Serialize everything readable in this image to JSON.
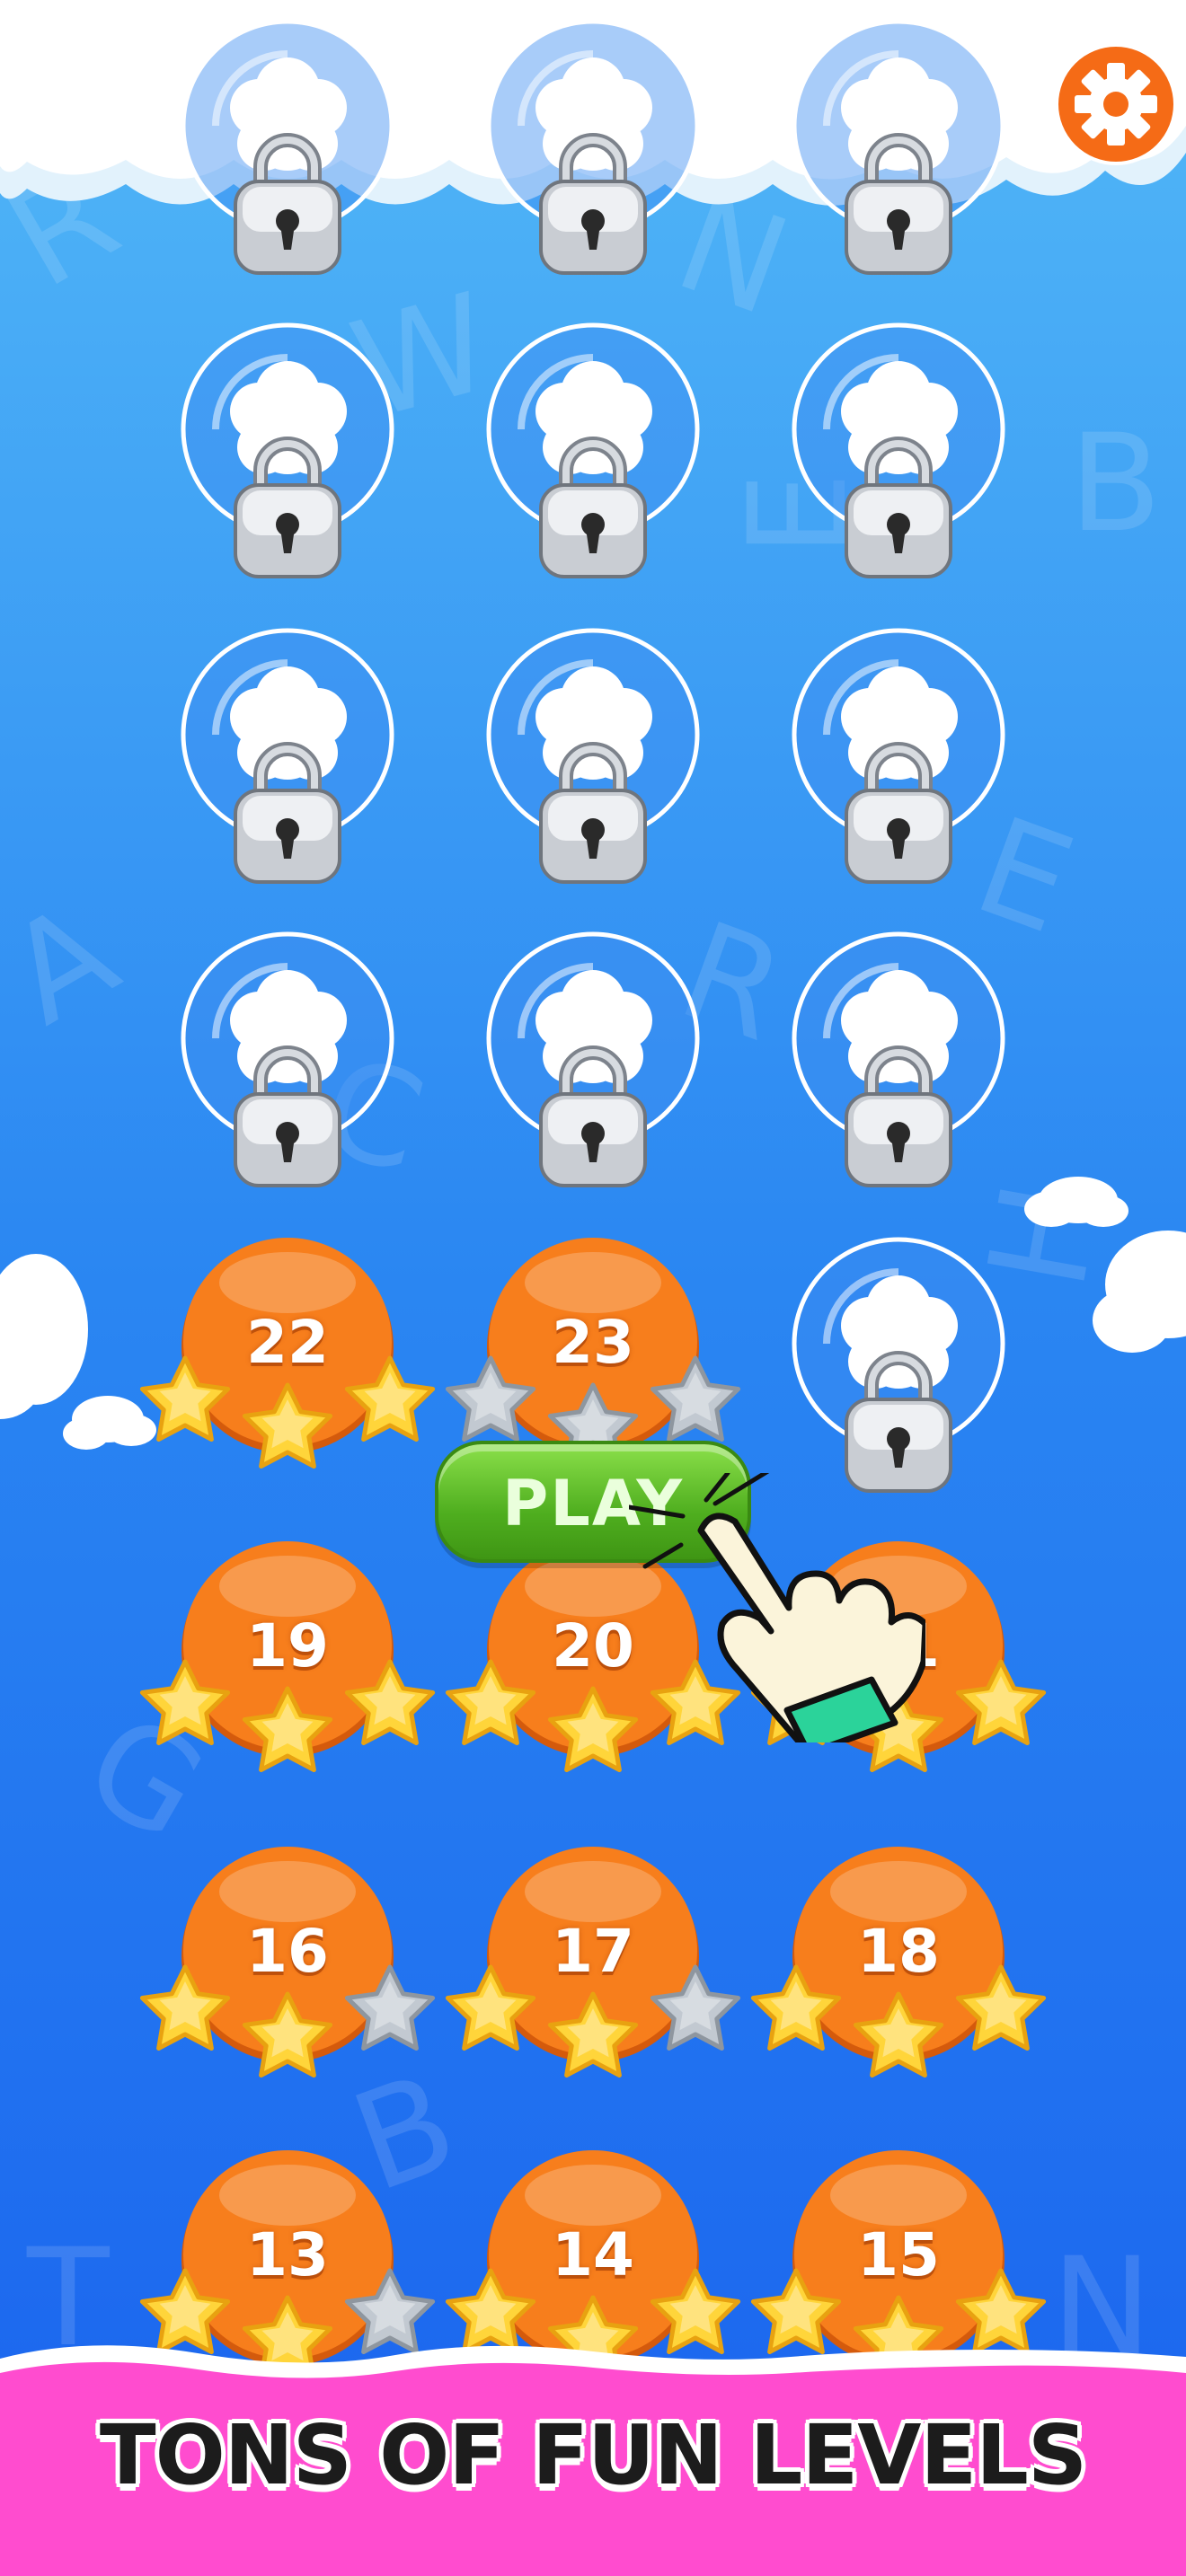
{
  "colors": {
    "sky_top": "#4fb6f6",
    "sky_bottom": "#1d6df0",
    "level_orange": "#f57d1d",
    "star_gold": "#ffd53a",
    "star_empty": "#b9c2cc",
    "play_green": "#5dbb2a",
    "footer_pink": "#ff4fd0",
    "settings_orange": "#f5701a"
  },
  "settings": {
    "icon": "gear-icon"
  },
  "locked_levels": [
    {
      "row": 0,
      "col": 0
    },
    {
      "row": 0,
      "col": 1
    },
    {
      "row": 0,
      "col": 2
    },
    {
      "row": 1,
      "col": 0
    },
    {
      "row": 1,
      "col": 1
    },
    {
      "row": 1,
      "col": 2
    },
    {
      "row": 2,
      "col": 0
    },
    {
      "row": 2,
      "col": 1
    },
    {
      "row": 2,
      "col": 2
    },
    {
      "row": 3,
      "col": 0
    },
    {
      "row": 3,
      "col": 1
    },
    {
      "row": 3,
      "col": 2
    },
    {
      "row": 4,
      "col": 2
    }
  ],
  "levels": [
    {
      "number": "22",
      "stars": 3,
      "row": 4,
      "col": 0
    },
    {
      "number": "23",
      "stars": 0,
      "row": 4,
      "col": 1
    },
    {
      "number": "19",
      "stars": 3,
      "row": 5,
      "col": 0
    },
    {
      "number": "20",
      "stars": 3,
      "row": 5,
      "col": 1
    },
    {
      "number": "21",
      "stars": 3,
      "row": 5,
      "col": 2
    },
    {
      "number": "16",
      "stars": 2,
      "row": 6,
      "col": 0
    },
    {
      "number": "17",
      "stars": 2,
      "row": 6,
      "col": 1
    },
    {
      "number": "18",
      "stars": 3,
      "row": 6,
      "col": 2
    },
    {
      "number": "13",
      "stars": 2,
      "row": 7,
      "col": 0
    },
    {
      "number": "14",
      "stars": 3,
      "row": 7,
      "col": 1
    },
    {
      "number": "15",
      "stars": 3,
      "row": 7,
      "col": 2
    }
  ],
  "play_button": {
    "label": "PLAY"
  },
  "tutorial_hand": {
    "icon": "pointing-hand-icon"
  },
  "footer": {
    "tagline": "TONS OF FUN LEVELS"
  }
}
